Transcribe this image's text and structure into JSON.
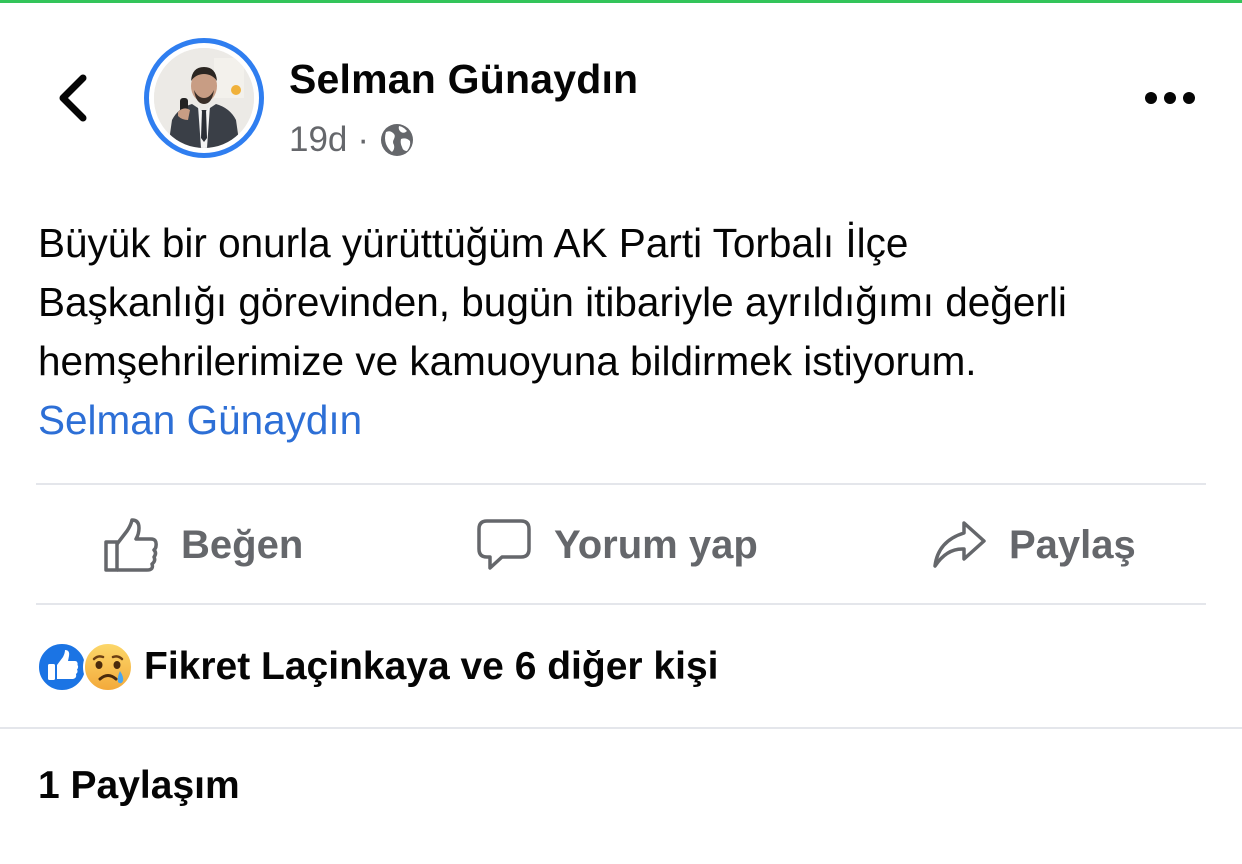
{
  "post": {
    "author": "Selman Günaydın",
    "timestamp": "19d",
    "separator": "·",
    "privacy_icon": "globe-icon",
    "text_lines": [
      "Büyük bir onurla yürüttüğüm AK Parti Torbalı İlçe",
      "Başkanlığı görevinden, bugün itibariyle ayrıldığımı değerli",
      "hemşehrilerimize ve kamuoyuna bildirmek istiyorum."
    ],
    "signature_link": "Selman Günaydın"
  },
  "actions": {
    "like_label": "Beğen",
    "comment_label": "Yorum yap",
    "share_label": "Paylaş"
  },
  "reactions": {
    "icons": [
      "like-reaction-icon",
      "sad-reaction-icon"
    ],
    "summary": "Fikret Laçinkaya ve 6 diğer kişi"
  },
  "shares": {
    "label": "1 Paylaşım"
  },
  "colors": {
    "accent_link": "#2d6fd6",
    "avatar_ring": "#2f7ef0",
    "secondary_text": "#65676b",
    "top_bar": "#33c45a"
  }
}
